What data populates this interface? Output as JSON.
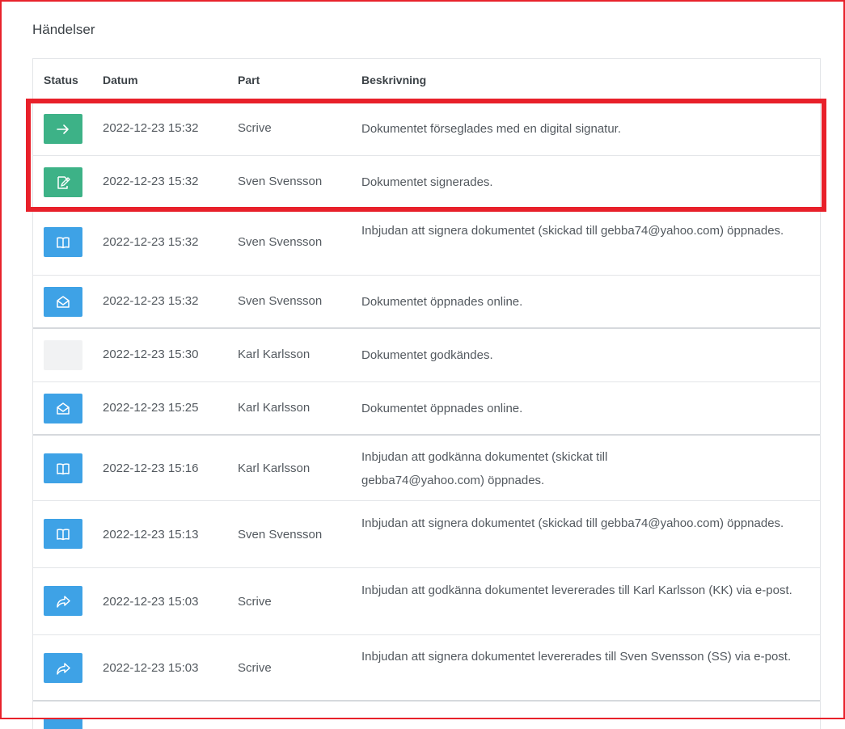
{
  "section": {
    "title": "Händelser"
  },
  "table": {
    "headers": {
      "status": "Status",
      "date": "Datum",
      "party": "Part",
      "description": "Beskrivning"
    },
    "rows": [
      {
        "status": "green-arrow",
        "date": "2022-12-23 15:32",
        "party": "Scrive",
        "description": "Dokumentet förseglades med en digital signatur."
      },
      {
        "status": "green-sign",
        "date": "2022-12-23 15:32",
        "party": "Sven Svensson",
        "description": "Dokumentet signerades."
      },
      {
        "status": "blue-book",
        "date": "2022-12-23 15:32",
        "party": "Sven Svensson",
        "description": "Inbjudan att signera dokumentet (skickad till gebba74@yahoo.com) öppnades."
      },
      {
        "status": "blue-envelope",
        "date": "2022-12-23 15:32",
        "party": "Sven Svensson",
        "description": "Dokumentet öppnades online."
      },
      {
        "status": "empty",
        "date": "2022-12-23 15:30",
        "party": "Karl Karlsson",
        "description": "Dokumentet godkändes."
      },
      {
        "status": "blue-envelope",
        "date": "2022-12-23 15:25",
        "party": "Karl Karlsson",
        "description": "Dokumentet öppnades online."
      },
      {
        "status": "blue-book",
        "date": "2022-12-23 15:16",
        "party": "Karl Karlsson",
        "description": "Inbjudan att godkänna dokumentet (skickat till gebba74@yahoo.com) öppnades."
      },
      {
        "status": "blue-book",
        "date": "2022-12-23 15:13",
        "party": "Sven Svensson",
        "description": "Inbjudan att signera dokumentet (skickad till gebba74@yahoo.com) öppnades."
      },
      {
        "status": "blue-forward",
        "date": "2022-12-23 15:03",
        "party": "Scrive",
        "description": "Inbjudan att godkänna dokumentet levererades till Karl Karlsson (KK) via e-post."
      },
      {
        "status": "blue-forward",
        "date": "2022-12-23 15:03",
        "party": "Scrive",
        "description": "Inbjudan att signera dokumentet levererades till Sven Svensson (SS) via e-post."
      }
    ]
  },
  "colors": {
    "green": "#3db287",
    "blue": "#3ea2e6",
    "highlight": "#e8202a"
  }
}
